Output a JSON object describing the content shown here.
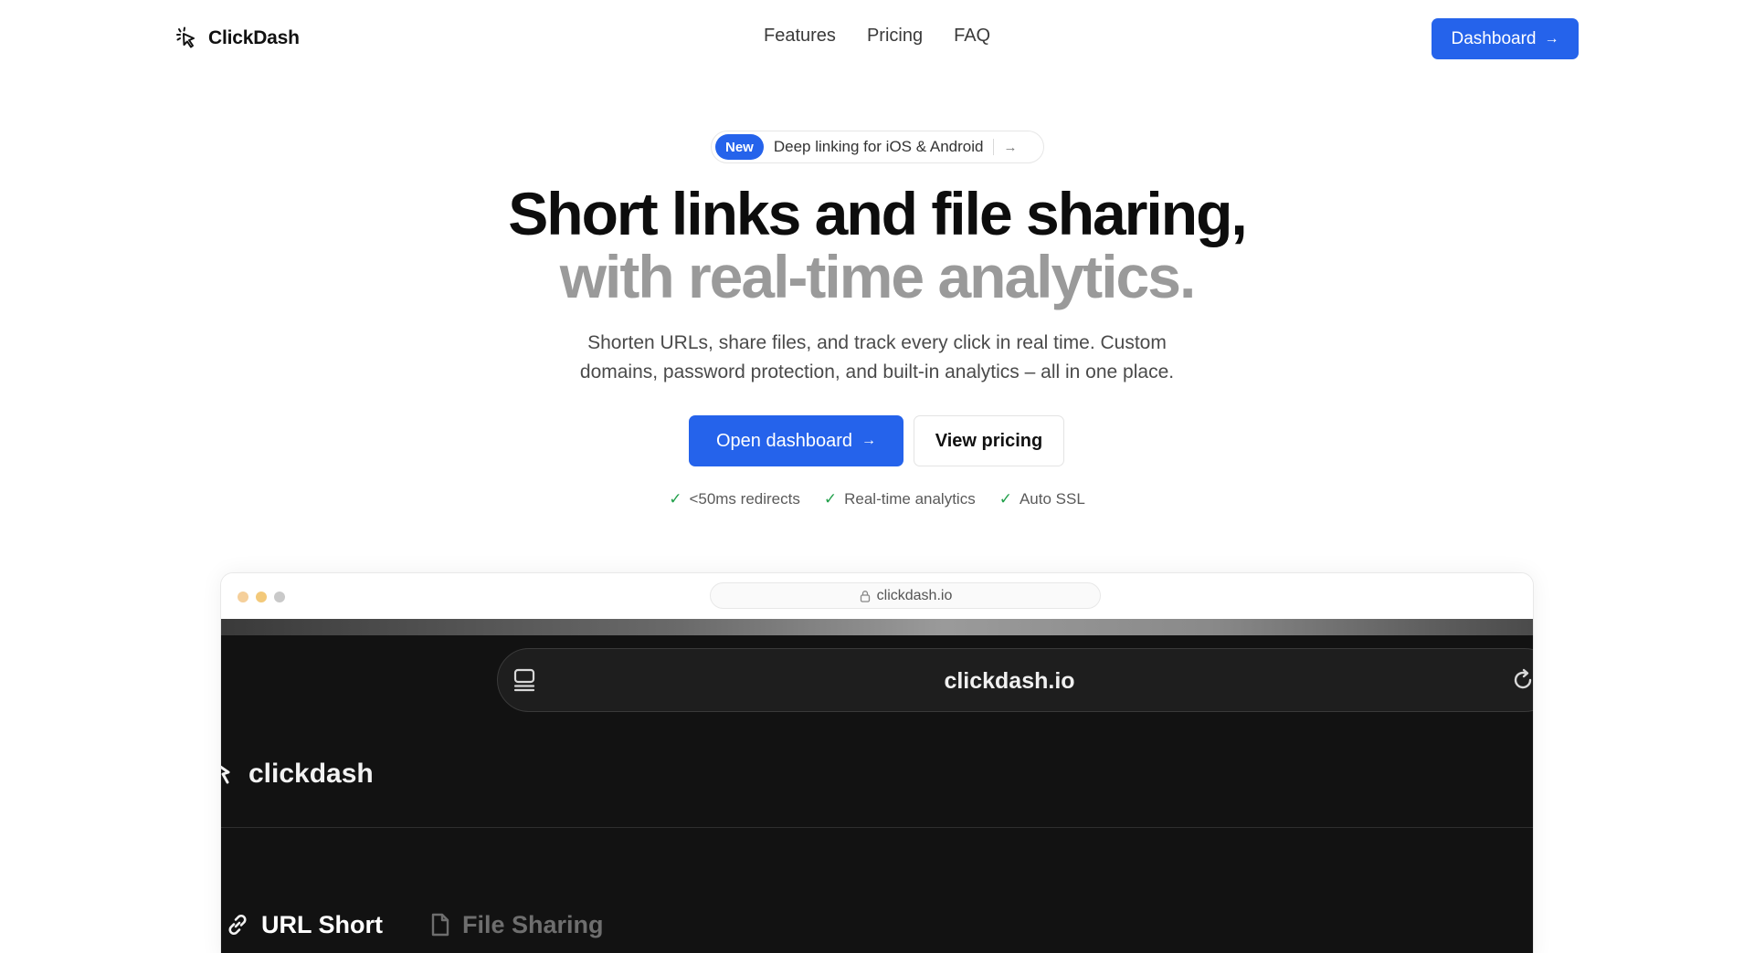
{
  "nav": {
    "brand_name": "ClickDash",
    "links": [
      "Features",
      "Pricing",
      "FAQ"
    ],
    "cta_label": "Dashboard"
  },
  "badge": {
    "tag": "New",
    "text": "Deep linking for iOS & Android"
  },
  "hero": {
    "line1": "Short links and file sharing,",
    "line2": "with real-time analytics.",
    "subtitle_line1": "Shorten URLs, share files, and track every click in real time. Custom",
    "subtitle_line2": "domains, password protection, and built-in analytics – all in one place.",
    "primary_button": "Open dashboard",
    "secondary_button": "View pricing"
  },
  "features": [
    "<50ms redirects",
    "Real-time analytics",
    "Auto SSL"
  ],
  "mockup": {
    "address": "clickdash.io",
    "inner_url": "clickdash.io",
    "inner_brand": "clickdash",
    "tabs": [
      {
        "label": "URL Short",
        "active": true,
        "icon": "link-icon"
      },
      {
        "label": "File Sharing",
        "active": false,
        "icon": "file-icon"
      }
    ]
  },
  "colors": {
    "accent": "#2563eb",
    "check": "#22a04b",
    "hero_muted": "#9a9a9a",
    "mockup_bg": "#121212"
  }
}
